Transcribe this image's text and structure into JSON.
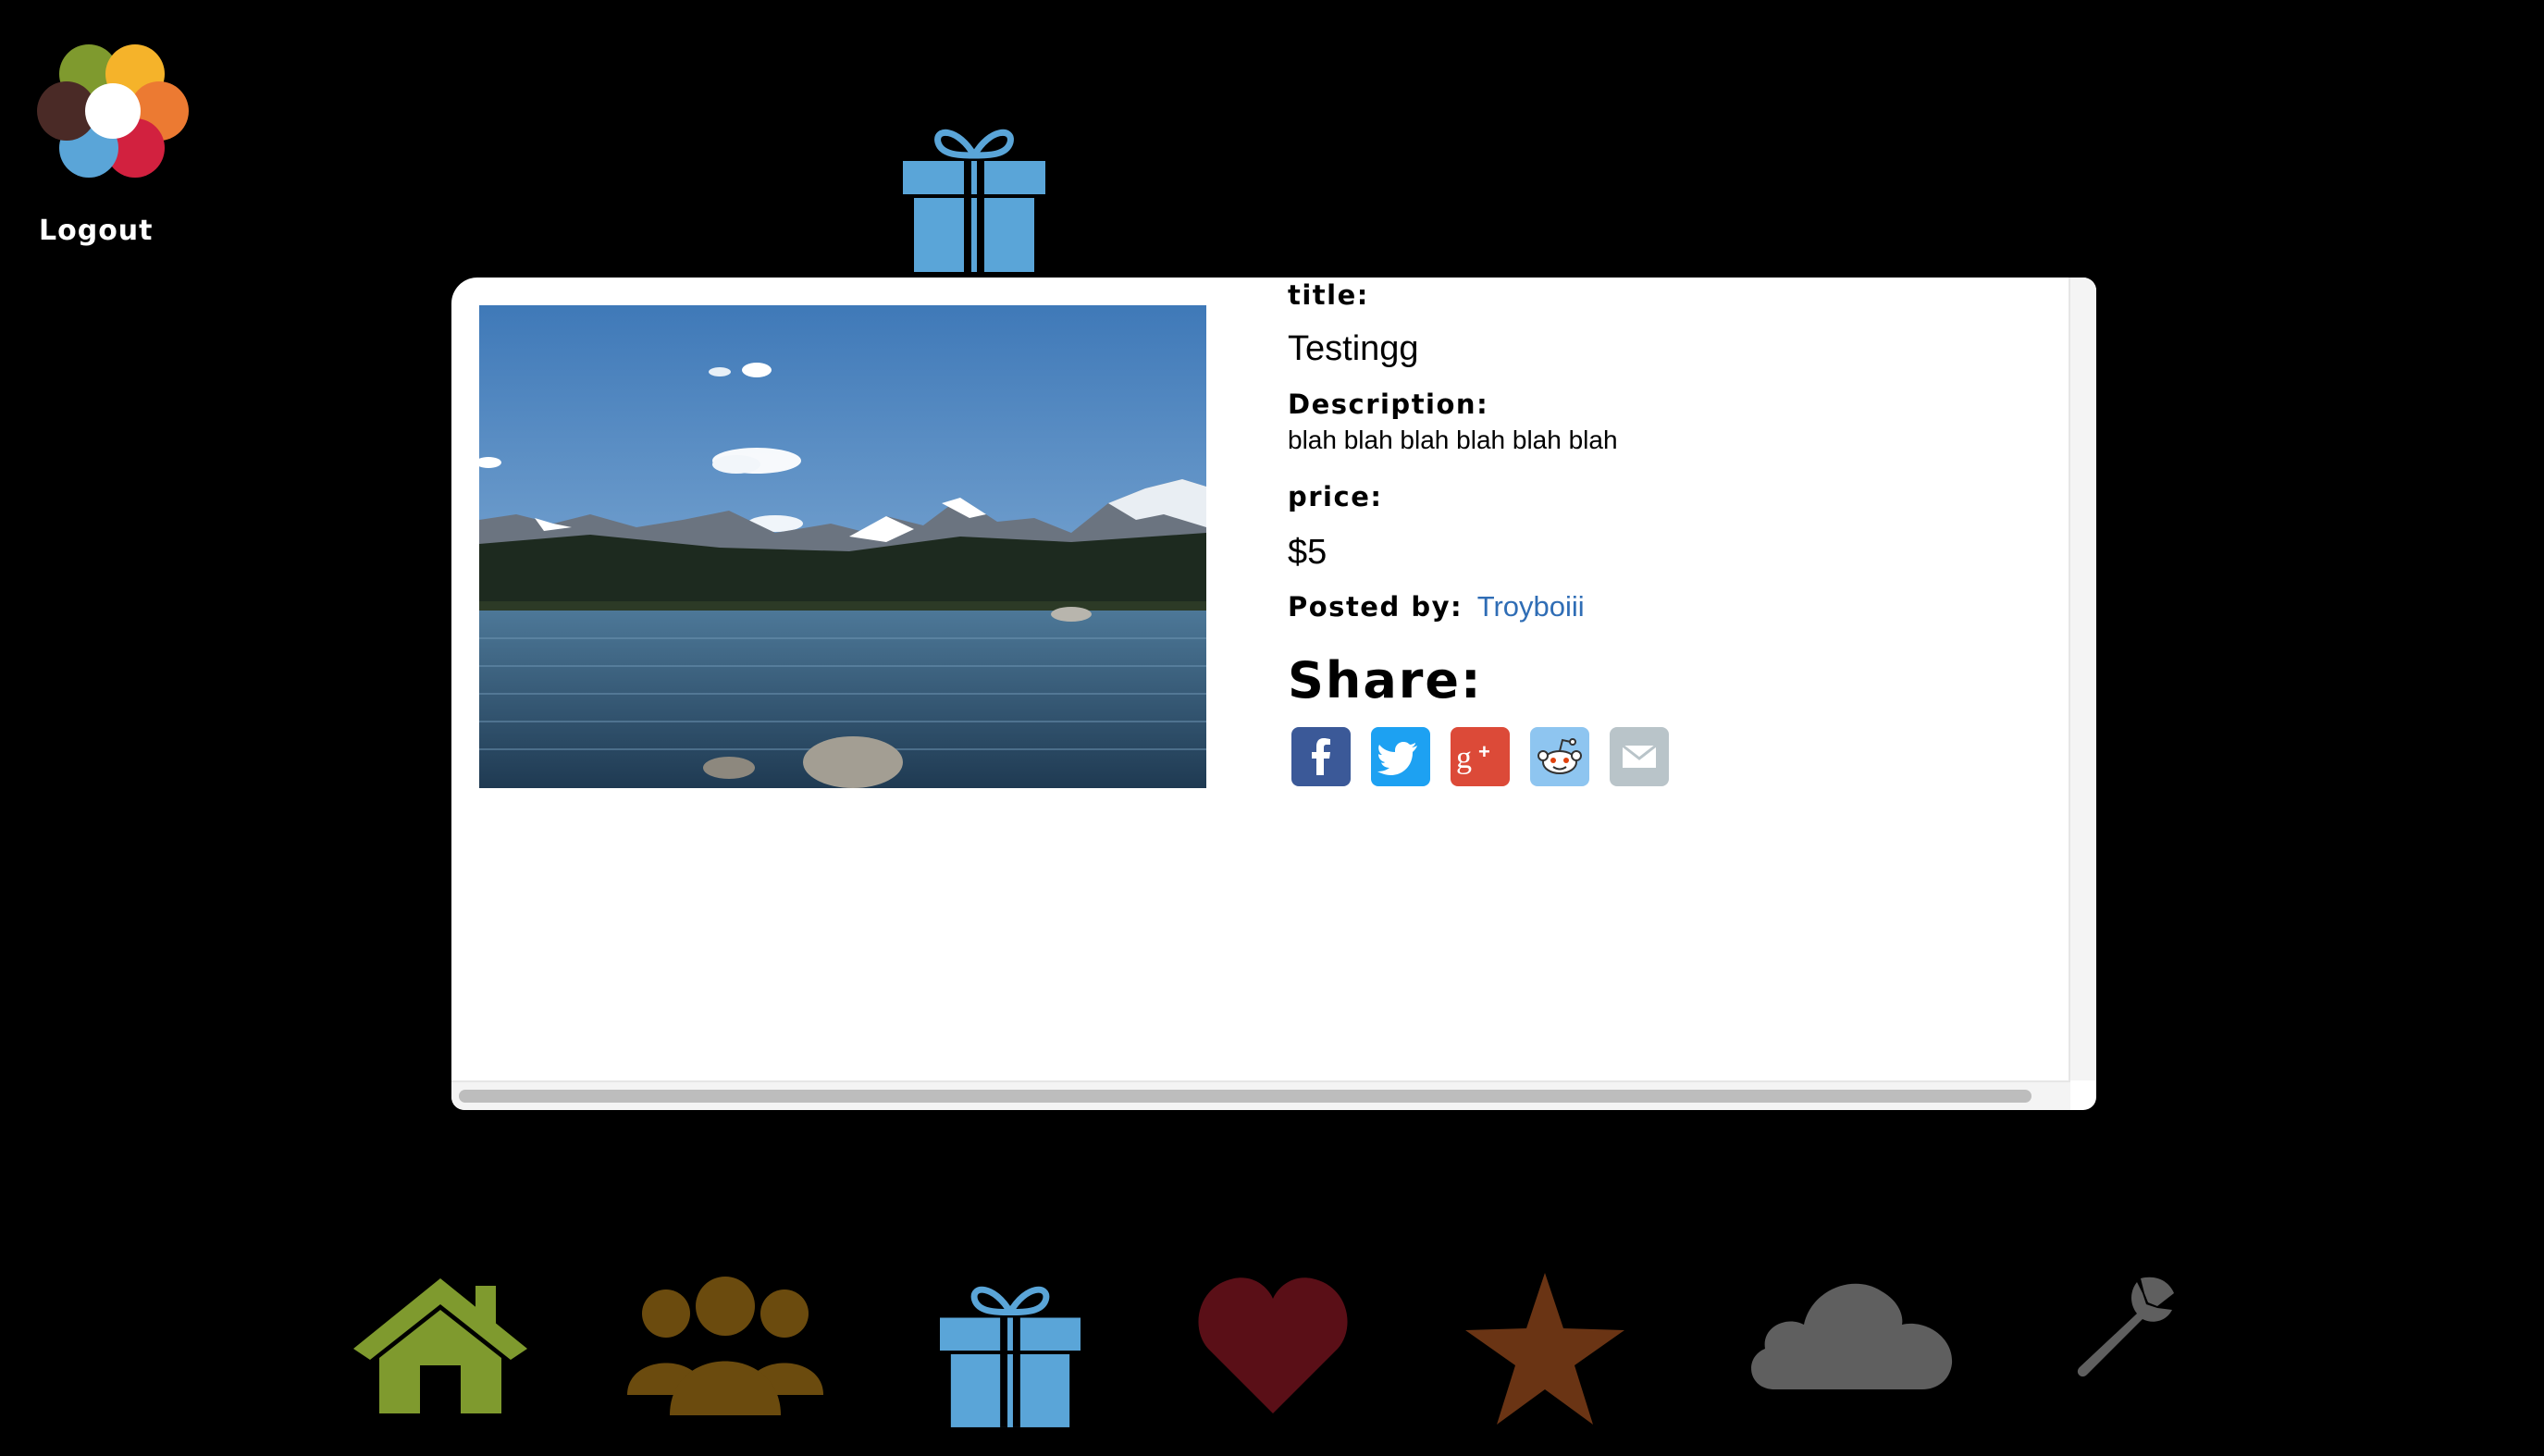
{
  "header": {
    "logo_icon": "flower-petals-logo",
    "logout_label": "Logout",
    "section_icon": "gift-icon"
  },
  "item": {
    "title_label": "title:",
    "title": "Testingg",
    "description_label": "Description:",
    "description": "blah blah blah blah blah blah",
    "price_label": "price:",
    "price": "$5",
    "posted_by_label": "Posted by:",
    "posted_by": "Troyboiii",
    "image_icon": "mountain-lake-photo"
  },
  "share": {
    "heading": "Share:",
    "buttons": [
      {
        "name": "facebook",
        "icon": "facebook-icon",
        "color": "#3b5998"
      },
      {
        "name": "twitter",
        "icon": "twitter-icon",
        "color": "#1da1f2"
      },
      {
        "name": "google-plus",
        "icon": "google-plus-icon",
        "color": "#dc4a38"
      },
      {
        "name": "reddit",
        "icon": "reddit-icon",
        "color": "#8ec5f0"
      },
      {
        "name": "email",
        "icon": "email-icon",
        "color": "#b9c4c9"
      }
    ]
  },
  "bottom_nav": [
    {
      "name": "home",
      "icon": "home-icon",
      "color": "#7f9a2e"
    },
    {
      "name": "friends",
      "icon": "people-icon",
      "color": "#6b4b0e"
    },
    {
      "name": "gifts",
      "icon": "gift-icon",
      "color": "#5aa5d8",
      "active": true
    },
    {
      "name": "favorites",
      "icon": "heart-icon",
      "color": "#5a0f17"
    },
    {
      "name": "starred",
      "icon": "star-icon",
      "color": "#6a3414"
    },
    {
      "name": "cloud",
      "icon": "cloud-icon",
      "color": "#5f5f5f"
    },
    {
      "name": "settings",
      "icon": "wrench-icon",
      "color": "#5f5f5f"
    }
  ],
  "colors": {
    "background": "#000000",
    "panel": "#ffffff",
    "link": "#2f6db5",
    "gift_blue": "#5aa5d8"
  }
}
